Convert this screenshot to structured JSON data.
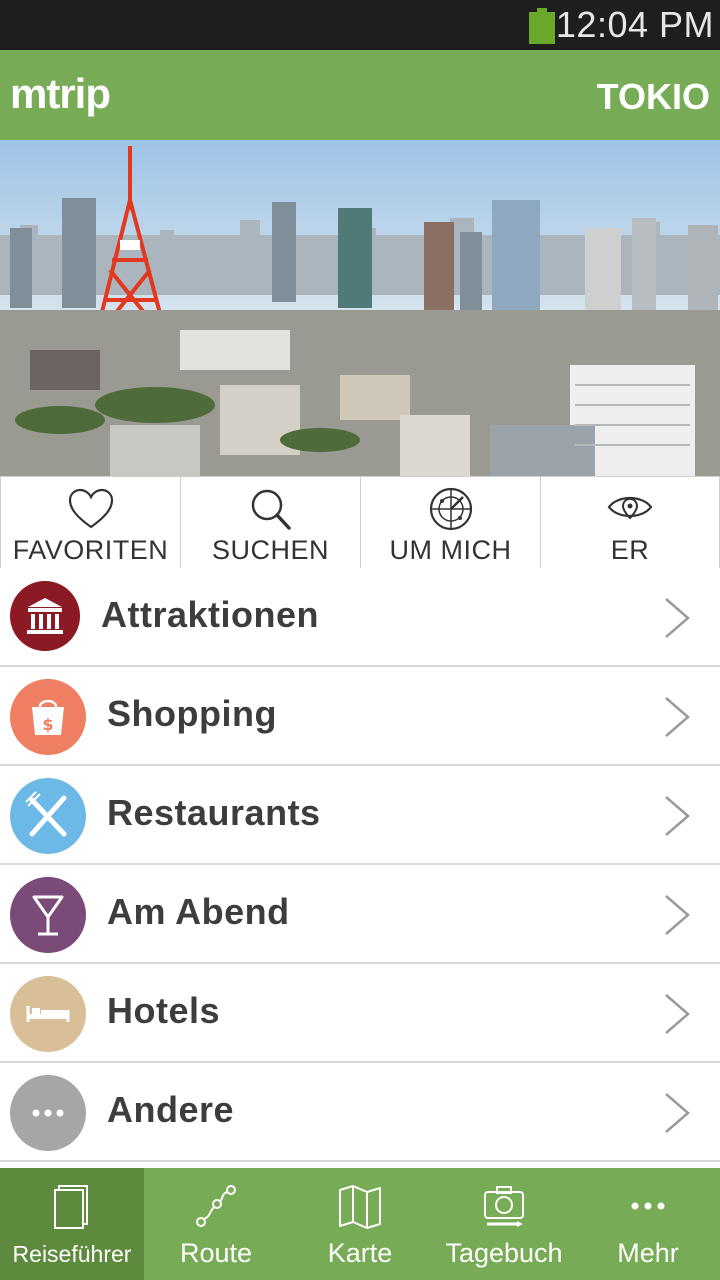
{
  "status_bar": {
    "time": "12:04 PM",
    "icons": [
      "battery-icon"
    ]
  },
  "app_bar": {
    "brand": "mtrip",
    "city": "TOKIO"
  },
  "hero": {
    "image": "tokyo-skyline-photo"
  },
  "quick_actions": [
    {
      "label": "FAVORITEN",
      "icon": "heart-icon"
    },
    {
      "label": "SUCHEN",
      "icon": "search-icon"
    },
    {
      "label": "UM MICH",
      "icon": "radar-icon"
    },
    {
      "label": "ER",
      "icon": "eye-icon"
    }
  ],
  "categories": [
    {
      "label": "Attraktionen",
      "icon": "museum-icon",
      "color": "#8b1a24"
    },
    {
      "label": "Shopping",
      "icon": "shopping-bag-icon",
      "color": "#ee7f63"
    },
    {
      "label": "Restaurants",
      "icon": "cutlery-icon",
      "color": "#6cb8e6"
    },
    {
      "label": "Am Abend",
      "icon": "cocktail-icon",
      "color": "#7a4a79"
    },
    {
      "label": "Hotels",
      "icon": "bed-icon",
      "color": "#d8bf98"
    },
    {
      "label": "Andere",
      "icon": "more-icon",
      "color": "#a6a6a6"
    }
  ],
  "tab_bar": [
    {
      "label": "Reiseführer",
      "icon": "guide-book-icon",
      "active": true
    },
    {
      "label": "Route",
      "icon": "route-icon",
      "active": false
    },
    {
      "label": "Karte",
      "icon": "map-icon",
      "active": false
    },
    {
      "label": "Tagebuch",
      "icon": "camera-icon",
      "active": false
    },
    {
      "label": "Mehr",
      "icon": "more-dots-icon",
      "active": false
    }
  ],
  "colors": {
    "accent": "#78ab55",
    "accent_dark": "#5e8a3d",
    "status_bar": "#1e1e1e"
  }
}
